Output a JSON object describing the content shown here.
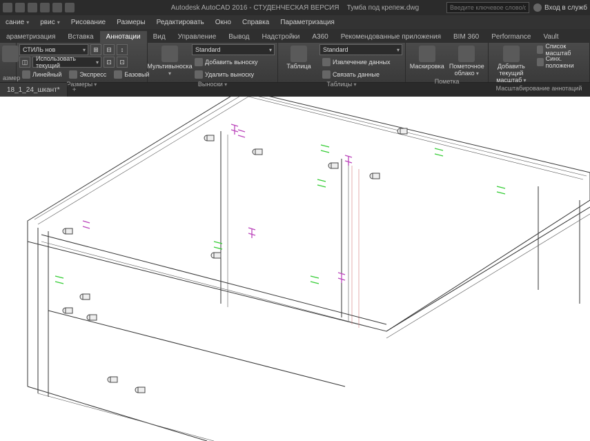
{
  "titlebar": {
    "app": "Autodesk AutoCAD 2016 - СТУДЕНЧЕСКАЯ ВЕРСИЯ",
    "file": "Тумба под крепеж.dwg",
    "search_placeholder": "Введите ключевое слово/фразу",
    "login": "Вход в служб"
  },
  "menu": {
    "items": [
      "сание",
      "рвис",
      "Рисование",
      "Размеры",
      "Редактировать",
      "Окно",
      "Справка",
      "Параметризация"
    ]
  },
  "tabs": {
    "items": [
      "араметризация",
      "Вставка",
      "Аннотации",
      "Вид",
      "Управление",
      "Вывод",
      "Надстройки",
      "A360",
      "Рекомендованные приложения",
      "BIM 360",
      "Performance",
      "Vault"
    ],
    "active": 2
  },
  "ribbon": {
    "dim": {
      "style": "СТИЛЬ нов",
      "use_current": "Использовать текущий",
      "linear": "Линейный",
      "express": "Экспресс",
      "base": "Базовый",
      "title": "Размеры",
      "left_label": "азмер"
    },
    "leaders": {
      "big": "Мультивыноска",
      "style": "Standard",
      "add": "Добавить выноску",
      "del": "Удалить выноску",
      "title": "Выноски"
    },
    "tables": {
      "big": "Таблица",
      "style": "Standard",
      "extract": "Извлечение данных",
      "link": "Связать данные",
      "title": "Таблицы"
    },
    "markup": {
      "mask": "Маскировка",
      "cloud": "Пометочное облако",
      "title": "Пометка"
    },
    "scale": {
      "add": "Добавить текущий масштаб",
      "list": "Список масштаб",
      "sync": "Синх. положени",
      "title": "Масштабирование аннотаций"
    }
  },
  "doctab": {
    "name": "18_1_24_шкант*"
  }
}
